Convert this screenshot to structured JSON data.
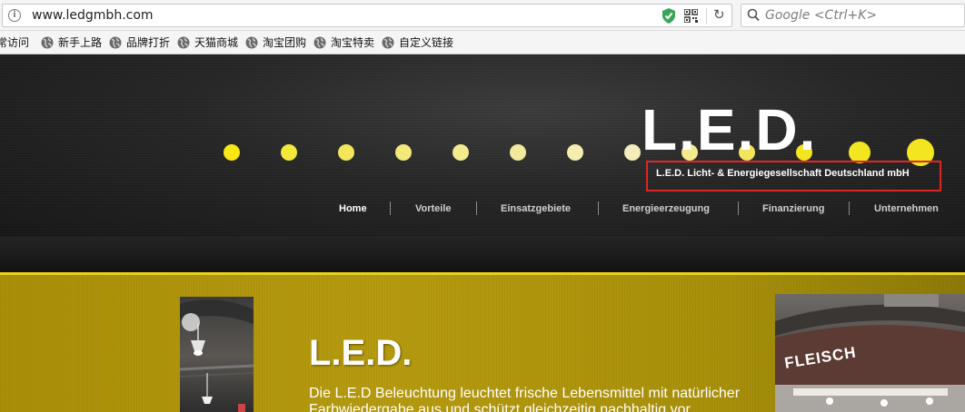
{
  "browser": {
    "url": "www.ledgmbh.com",
    "info_icon": "i",
    "search_placeholder": "Google <Ctrl+K>",
    "bookmarks": [
      {
        "label": "常访问",
        "icon": "globe-icon"
      },
      {
        "label": "新手上路",
        "icon": "globe-icon"
      },
      {
        "label": "品牌打折",
        "icon": "globe-icon"
      },
      {
        "label": "天猫商城",
        "icon": "globe-icon"
      },
      {
        "label": "淘宝团购",
        "icon": "globe-icon"
      },
      {
        "label": "淘宝特卖",
        "icon": "globe-icon"
      },
      {
        "label": "自定义链接",
        "icon": "globe-icon"
      }
    ]
  },
  "header": {
    "logo": "L.E.D.",
    "tagline": "L.E.D. Licht- & Energiegesellschaft Deutschland mbH",
    "dot_colors": [
      "#f7e815",
      "#f3e93a",
      "#f2e65a",
      "#f3e978",
      "#f3ea8d",
      "#f2e99c",
      "#f5eeb0",
      "#f4ecba",
      "#f3e98f",
      "#f2e55e",
      "#f3e51f"
    ]
  },
  "nav": {
    "items": [
      {
        "label": "Home",
        "active": true
      },
      {
        "label": "Vorteile",
        "active": false
      },
      {
        "label": "Einsatzgebiete",
        "active": false
      },
      {
        "label": "Energieerzeugung",
        "active": false
      },
      {
        "label": "Finanzierung",
        "active": false
      },
      {
        "label": "Unternehmen",
        "active": false
      }
    ]
  },
  "content": {
    "title": "L.E.D.",
    "text": "Die L.E.D Beleuchtung leuchtet frische Lebensmittel mit natürlicher Farbwiedergabe aus und schützt gleichzeitig nachhaltig vor",
    "right_image_sign": "FLEISCH"
  },
  "colors": {
    "accent_gold": "#e8d21a",
    "highlight_box": "#e02525"
  }
}
